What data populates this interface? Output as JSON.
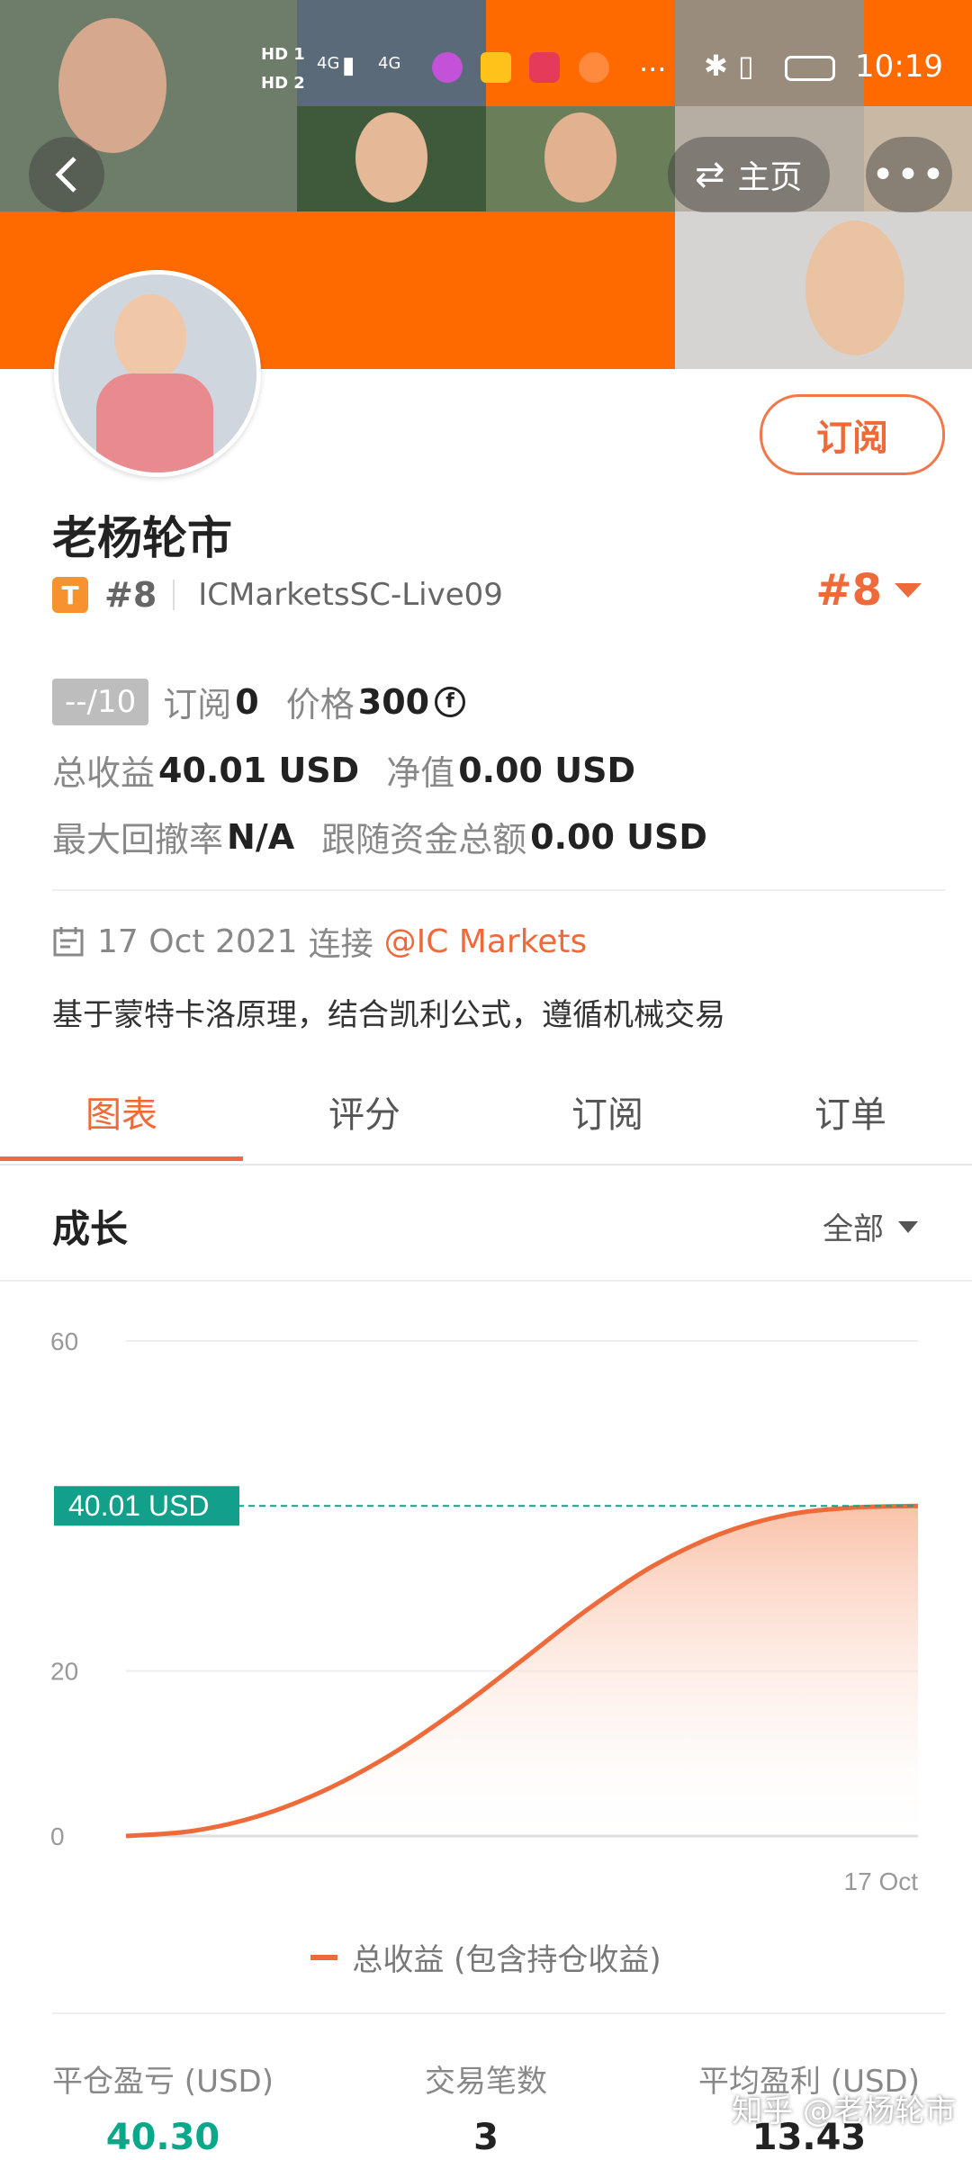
{
  "status_bar": {
    "hd1": "HD 1",
    "hd2": "HD 2",
    "net1": "4G",
    "net2": "4G",
    "more": "···",
    "time": "10:19"
  },
  "nav": {
    "home_label": "主页"
  },
  "profile": {
    "name": "老杨轮市",
    "level_badge": "T",
    "rank": "#8",
    "account": "ICMarketsSC-Live09",
    "rank_right": "#8",
    "subscribe_label": "订阅"
  },
  "stats": {
    "score": "--/10",
    "subscribe_label": "订阅",
    "subscribe_value": "0",
    "price_label": "价格",
    "price_value": "300",
    "total_profit_label": "总收益",
    "total_profit_value": "40.01 USD",
    "net_value_label": "净值",
    "net_value_value": "0.00 USD",
    "max_drawdown_label": "最大回撤率",
    "max_drawdown_value": "N/A",
    "follow_total_label": "跟随资金总额",
    "follow_total_value": "0.00 USD"
  },
  "info": {
    "date": "17 Oct 2021",
    "connect_label": "连接",
    "broker": "@IC Markets",
    "description": "基于蒙特卡洛原理，结合凯利公式，遵循机械交易"
  },
  "tabs": [
    "图表",
    "评分",
    "订阅",
    "订单"
  ],
  "section": {
    "title": "成长",
    "filter": "全部"
  },
  "chart_data": {
    "type": "area",
    "y_ticks": [
      "60",
      "20",
      "0"
    ],
    "ylim": [
      0,
      60
    ],
    "x_label": "17 Oct",
    "series": [
      {
        "name": "总收益 (包含持仓收益)",
        "values": [
          0,
          0.6,
          2.4,
          5.5,
          9.8,
          15.2,
          21.3,
          27.5,
          32.8,
          36.6,
          38.9,
          39.8,
          40.01
        ]
      }
    ],
    "current_label": "40.01 USD",
    "current_value": 40.01,
    "colors": {
      "line": "#ef6a3a",
      "fill": "#fbd3c1",
      "marker": "#12a08a"
    }
  },
  "legend": {
    "label": "总收益 (包含持仓收益)"
  },
  "bottom": {
    "closed_pl_label": "平仓盈亏 (USD)",
    "closed_pl_value": "40.30",
    "trades_label": "交易笔数",
    "trades_value": "3",
    "avg_profit_label": "平均盈利 (USD)",
    "avg_profit_value": "13.43"
  },
  "watermark": "知乎 @老杨轮市"
}
